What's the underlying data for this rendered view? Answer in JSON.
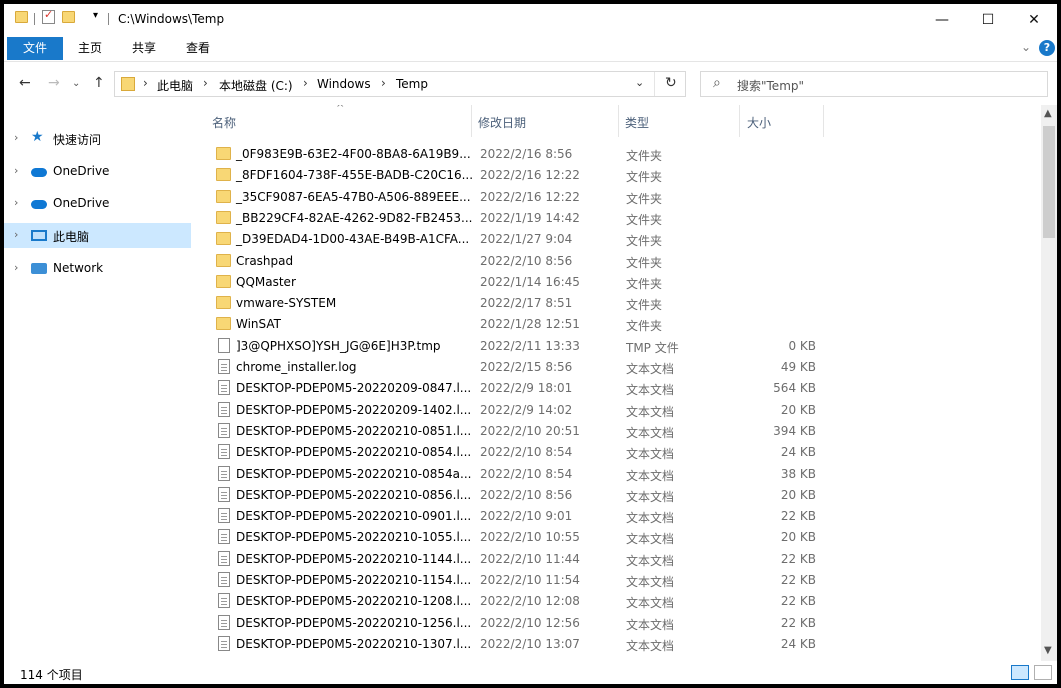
{
  "window": {
    "title": "C:\\Windows\\Temp",
    "minimize": "—",
    "maximize": "☐",
    "close": "✕"
  },
  "ribbon": {
    "tabs": [
      "文件",
      "主页",
      "共享",
      "查看"
    ],
    "help": "?"
  },
  "address": {
    "crumbs": [
      "此电脑",
      "本地磁盘 (C:)",
      "Windows",
      "Temp"
    ],
    "search_placeholder": "搜索\"Temp\""
  },
  "nav": {
    "items": [
      {
        "label": "快速访问",
        "icon": "star-icon"
      },
      {
        "label": "OneDrive",
        "icon": "cloud-icon"
      },
      {
        "label": "OneDrive",
        "icon": "cloud-icon"
      },
      {
        "label": "此电脑",
        "icon": "computer-icon",
        "selected": true
      },
      {
        "label": "Network",
        "icon": "network-icon"
      }
    ]
  },
  "columns": {
    "name": "名称",
    "date": "修改日期",
    "type": "类型",
    "size": "大小"
  },
  "files": [
    {
      "name": "_0F983E9B-63E2-4F00-8BA8-6A19B9...",
      "date": "2022/2/16 8:56",
      "type": "文件夹",
      "size": "",
      "kind": "folder"
    },
    {
      "name": "_8FDF1604-738F-455E-BADB-C20C16...",
      "date": "2022/2/16 12:22",
      "type": "文件夹",
      "size": "",
      "kind": "folder"
    },
    {
      "name": "_35CF9087-6EA5-47B0-A506-889EEE...",
      "date": "2022/2/16 12:22",
      "type": "文件夹",
      "size": "",
      "kind": "folder"
    },
    {
      "name": "_BB229CF4-82AE-4262-9D82-FB2453...",
      "date": "2022/1/19 14:42",
      "type": "文件夹",
      "size": "",
      "kind": "folder"
    },
    {
      "name": "_D39EDAD4-1D00-43AE-B49B-A1CFA...",
      "date": "2022/1/27 9:04",
      "type": "文件夹",
      "size": "",
      "kind": "folder"
    },
    {
      "name": "Crashpad",
      "date": "2022/2/10 8:56",
      "type": "文件夹",
      "size": "",
      "kind": "folder"
    },
    {
      "name": "QQMaster",
      "date": "2022/1/14 16:45",
      "type": "文件夹",
      "size": "",
      "kind": "folder"
    },
    {
      "name": "vmware-SYSTEM",
      "date": "2022/2/17 8:51",
      "type": "文件夹",
      "size": "",
      "kind": "folder"
    },
    {
      "name": "WinSAT",
      "date": "2022/1/28 12:51",
      "type": "文件夹",
      "size": "",
      "kind": "folder"
    },
    {
      "name": "]3@QPHXSO]YSH_JG@6E]H3P.tmp",
      "date": "2022/2/11 13:33",
      "type": "TMP 文件",
      "size": "0 KB",
      "kind": "tmp"
    },
    {
      "name": "chrome_installer.log",
      "date": "2022/2/15 8:56",
      "type": "文本文档",
      "size": "49 KB",
      "kind": "doc"
    },
    {
      "name": "DESKTOP-PDEP0M5-20220209-0847.l...",
      "date": "2022/2/9 18:01",
      "type": "文本文档",
      "size": "564 KB",
      "kind": "doc"
    },
    {
      "name": "DESKTOP-PDEP0M5-20220209-1402.l...",
      "date": "2022/2/9 14:02",
      "type": "文本文档",
      "size": "20 KB",
      "kind": "doc"
    },
    {
      "name": "DESKTOP-PDEP0M5-20220210-0851.l...",
      "date": "2022/2/10 20:51",
      "type": "文本文档",
      "size": "394 KB",
      "kind": "doc"
    },
    {
      "name": "DESKTOP-PDEP0M5-20220210-0854.l...",
      "date": "2022/2/10 8:54",
      "type": "文本文档",
      "size": "24 KB",
      "kind": "doc"
    },
    {
      "name": "DESKTOP-PDEP0M5-20220210-0854a...",
      "date": "2022/2/10 8:54",
      "type": "文本文档",
      "size": "38 KB",
      "kind": "doc"
    },
    {
      "name": "DESKTOP-PDEP0M5-20220210-0856.l...",
      "date": "2022/2/10 8:56",
      "type": "文本文档",
      "size": "20 KB",
      "kind": "doc"
    },
    {
      "name": "DESKTOP-PDEP0M5-20220210-0901.l...",
      "date": "2022/2/10 9:01",
      "type": "文本文档",
      "size": "22 KB",
      "kind": "doc"
    },
    {
      "name": "DESKTOP-PDEP0M5-20220210-1055.l...",
      "date": "2022/2/10 10:55",
      "type": "文本文档",
      "size": "20 KB",
      "kind": "doc"
    },
    {
      "name": "DESKTOP-PDEP0M5-20220210-1144.l...",
      "date": "2022/2/10 11:44",
      "type": "文本文档",
      "size": "22 KB",
      "kind": "doc"
    },
    {
      "name": "DESKTOP-PDEP0M5-20220210-1154.l...",
      "date": "2022/2/10 11:54",
      "type": "文本文档",
      "size": "22 KB",
      "kind": "doc"
    },
    {
      "name": "DESKTOP-PDEP0M5-20220210-1208.l...",
      "date": "2022/2/10 12:08",
      "type": "文本文档",
      "size": "22 KB",
      "kind": "doc"
    },
    {
      "name": "DESKTOP-PDEP0M5-20220210-1256.l...",
      "date": "2022/2/10 12:56",
      "type": "文本文档",
      "size": "22 KB",
      "kind": "doc"
    },
    {
      "name": "DESKTOP-PDEP0M5-20220210-1307.l...",
      "date": "2022/2/10 13:07",
      "type": "文本文档",
      "size": "24 KB",
      "kind": "doc"
    }
  ],
  "status": {
    "count": "114 个项目"
  },
  "colors": {
    "accent": "#1979ca",
    "selection": "#cce8ff",
    "folder": "#f8d775"
  }
}
